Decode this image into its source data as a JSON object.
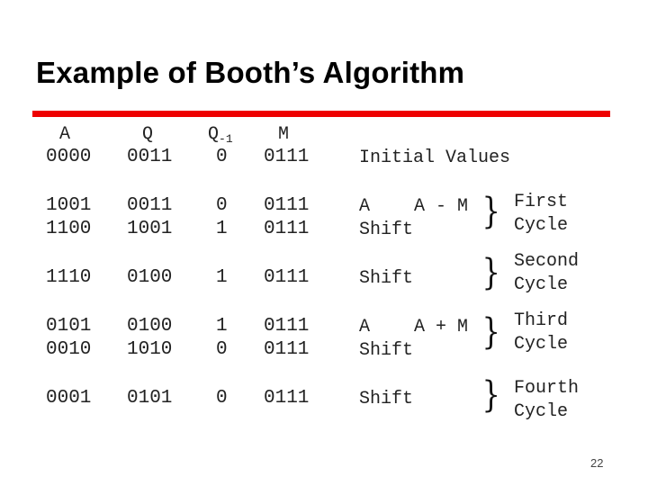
{
  "slide": {
    "title": "Example of Booth’s Algorithm",
    "page_number": "22",
    "accent_color": "#ee0000"
  },
  "table": {
    "headers": {
      "a": "A",
      "q": "Q",
      "q_minus_1": "Q",
      "q_minus_1_sub": "-1",
      "m": "M"
    },
    "rows": [
      {
        "a": "0000",
        "q": "0011",
        "q_minus_1": "0",
        "m": "0111",
        "op": "Initial Values"
      },
      {
        "a": "1001",
        "q": "0011",
        "q_minus_1": "0",
        "m": "0111",
        "op": "A ← A - M"
      },
      {
        "a": "1100",
        "q": "1001",
        "q_minus_1": "1",
        "m": "0111",
        "op": "Shift"
      },
      {
        "a": "1110",
        "q": "0100",
        "q_minus_1": "1",
        "m": "0111",
        "op": "Shift"
      },
      {
        "a": "0101",
        "q": "0100",
        "q_minus_1": "1",
        "m": "0111",
        "op": "A ← A + M"
      },
      {
        "a": "0010",
        "q": "1010",
        "q_minus_1": "0",
        "m": "0111",
        "op": "Shift"
      },
      {
        "a": "0001",
        "q": "0101",
        "q_minus_1": "0",
        "m": "0111",
        "op": "Shift"
      }
    ]
  },
  "cycles": [
    {
      "line1": "First",
      "line2": "Cycle"
    },
    {
      "line1": "Second",
      "line2": "Cycle"
    },
    {
      "line1": "Third",
      "line2": "Cycle"
    },
    {
      "line1": "Fourth",
      "line2": "Cycle"
    }
  ],
  "op_parts": {
    "sub": {
      "lhs": "A",
      "rhs": "A - M"
    },
    "add": {
      "lhs": "A",
      "rhs": "A + M"
    }
  },
  "brace_glyph": "}"
}
